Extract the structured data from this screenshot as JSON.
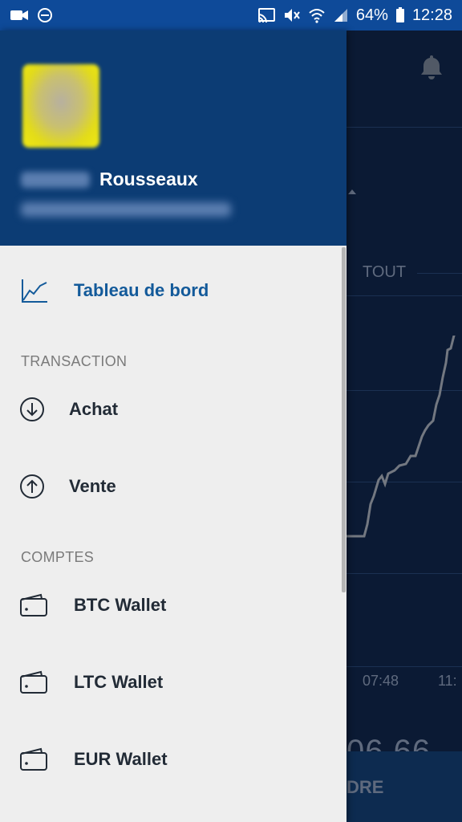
{
  "status_bar": {
    "battery": "64%",
    "time": "12:28",
    "icons": [
      "video-camera-icon",
      "do-not-disturb-icon",
      "cast-icon",
      "mute-icon",
      "wifi-icon",
      "signal-icon",
      "battery-icon"
    ]
  },
  "background": {
    "filter_label": "TOUT",
    "time_ticks": [
      "07:48",
      "11:"
    ],
    "value_partial": "06.66",
    "button_partial": "DRE"
  },
  "drawer": {
    "user": {
      "last_name": "Rousseaux"
    },
    "dashboard_label": "Tableau de bord",
    "sections": {
      "transaction": "TRANSACTION",
      "comptes": "COMPTES"
    },
    "transaction_items": [
      {
        "label": "Achat",
        "icon": "arrow-down-circle-icon"
      },
      {
        "label": "Vente",
        "icon": "arrow-up-circle-icon"
      }
    ],
    "wallets": [
      {
        "label": "BTC Wallet",
        "icon": "wallet-icon"
      },
      {
        "label": "LTC Wallet",
        "icon": "wallet-icon"
      },
      {
        "label": "EUR Wallet",
        "icon": "wallet-icon"
      }
    ]
  },
  "colors": {
    "status_bar": "#0e4a99",
    "drawer_header": "#0c3c74",
    "active_item": "#135a9a",
    "drawer_bg": "#eeeeee",
    "background_app": "#0f2346"
  }
}
